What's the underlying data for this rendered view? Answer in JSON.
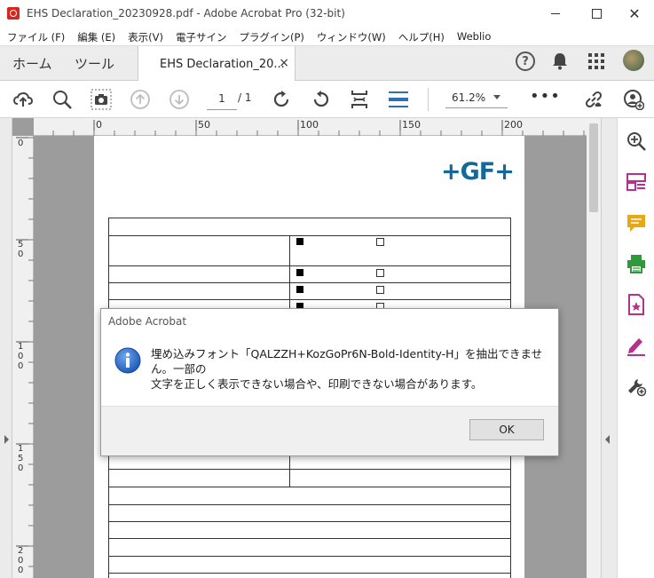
{
  "window": {
    "title": "EHS Declaration_20230928.pdf - Adobe Acrobat Pro (32-bit)",
    "min_icon": "minimize-icon",
    "max_icon": "maximize-icon",
    "close_icon": "close-icon"
  },
  "menu": {
    "items": [
      "ファイル (F)",
      "編集 (E)",
      "表示(V)",
      "電子サイン",
      "プラグイン(P)",
      "ウィンドウ(W)",
      "ヘルプ(H)",
      "Weblio"
    ]
  },
  "tabs": {
    "home": "ホーム",
    "tools": "ツール",
    "document": "EHS Declaration_20...",
    "document_close": "×"
  },
  "header_icons": [
    "help-icon",
    "bell-icon",
    "apps-icon",
    "avatar"
  ],
  "help_glyph": "?",
  "toolbar": {
    "page_current": "1",
    "page_total": "/ 1",
    "zoom": "61.2%",
    "more": "•••"
  },
  "ruler": {
    "horizontal": [
      "0",
      "50",
      "100",
      "150",
      "200"
    ],
    "vertical": [
      [
        "0"
      ],
      [
        "5",
        "0"
      ],
      [
        "1",
        "0",
        "0"
      ],
      [
        "1",
        "5",
        "0"
      ],
      [
        "2",
        "0",
        "0"
      ]
    ]
  },
  "document": {
    "logo": "+GF+"
  },
  "dialog": {
    "title": "Adobe Acrobat",
    "message": "埋め込みフォント「QALZZH+KozGoPr6N-Bold-Identity-H」を抽出できません。一部の\n文字を正しく表示できない場合や、印刷できない場合があります。",
    "ok": "OK",
    "icon": "info-icon"
  },
  "colors": {
    "logo_blue": "#14699a",
    "acrobat_red": "#d7261e",
    "accent_pink": "#b4318c",
    "accent_green": "#2e9a3a",
    "accent_yellow": "#e6a817",
    "info_blue": "#1f5bb8"
  }
}
